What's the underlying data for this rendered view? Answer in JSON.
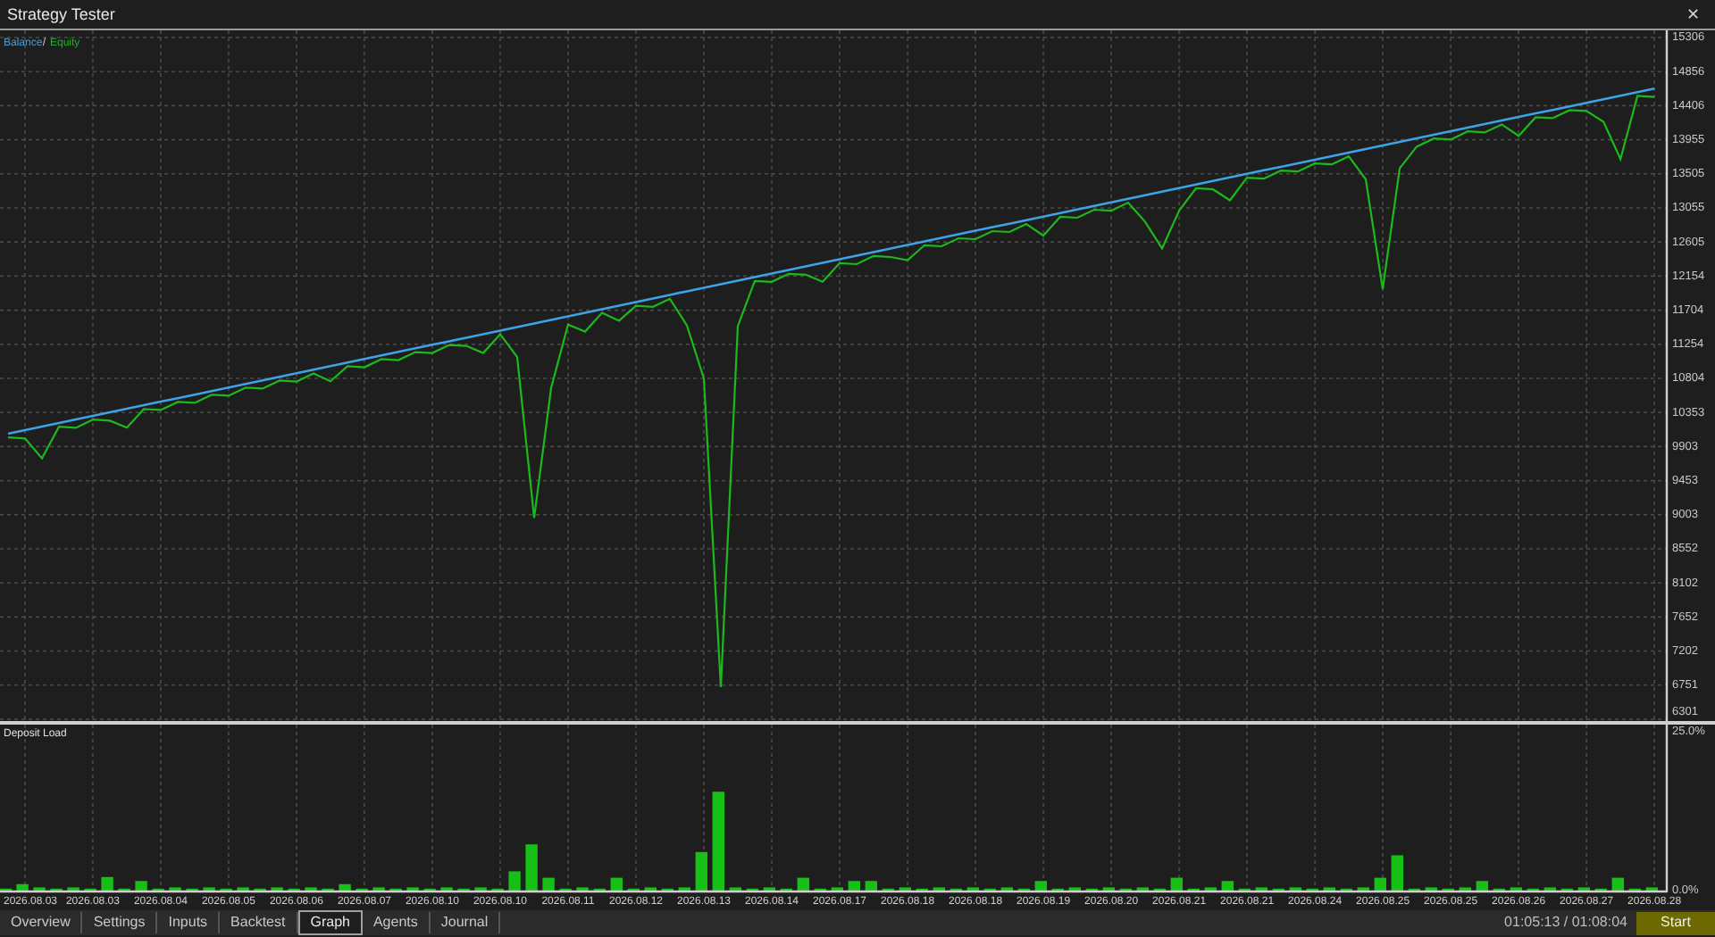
{
  "window": {
    "title": "Strategy Tester",
    "close": "✕"
  },
  "main_chart": {
    "legend_separator": "/",
    "chart_data": {
      "type": "line",
      "grid": true,
      "ylim": [
        6301,
        15306
      ],
      "yticks": [
        15306,
        14856,
        14406,
        13955,
        13505,
        13055,
        12605,
        12154,
        11704,
        11254,
        10804,
        10353,
        9903,
        9453,
        9003,
        8552,
        8102,
        7652,
        7202,
        6751,
        6301
      ],
      "series": [
        {
          "name": "Balance",
          "color": "#3ea2e6",
          "values": [
            10073,
            10120,
            10167,
            10214,
            10261,
            10308,
            10355,
            10402,
            10449,
            10496,
            10543,
            10590,
            10637,
            10684,
            10731,
            10778,
            10825,
            10872,
            10919,
            10966,
            11013,
            11060,
            11107,
            11154,
            11201,
            11248,
            11295,
            11342,
            11389,
            11436,
            11483,
            11530,
            11577,
            11624,
            11671,
            11718,
            11765,
            11812,
            11859,
            11906,
            11953,
            12000,
            12047,
            12094,
            12141,
            12188,
            12235,
            12282,
            12329,
            12376,
            12423,
            12470,
            12517,
            12564,
            12611,
            12658,
            12705,
            12752,
            12799,
            12846,
            12893,
            12940,
            12987,
            13034,
            13081,
            13128,
            13175,
            13222,
            13269,
            13316,
            13363,
            13410,
            13457,
            13504,
            13551,
            13598,
            13645,
            13692,
            13739,
            13786,
            13833,
            13880,
            13927,
            13974,
            14021,
            14068,
            14115,
            14162,
            14209,
            14256,
            14303,
            14350,
            14397,
            14444,
            14491,
            14538,
            14585,
            14632
          ]
        },
        {
          "name": "Equity",
          "color": "#1cb81c",
          "values": [
            10023,
            10010,
            9747,
            10164,
            10151,
            10258,
            10245,
            10152,
            10399,
            10386,
            10493,
            10480,
            10587,
            10574,
            10681,
            10668,
            10775,
            10762,
            10869,
            10766,
            10963,
            10950,
            11057,
            11044,
            11151,
            11138,
            11245,
            11232,
            11139,
            11386,
            11083,
            8960,
            10677,
            11514,
            11421,
            11668,
            11565,
            11762,
            11749,
            11856,
            11503,
            10800,
            6726,
            11494,
            12091,
            12078,
            12185,
            12172,
            12079,
            12326,
            12313,
            12420,
            12407,
            12364,
            12561,
            12548,
            12655,
            12642,
            12749,
            12736,
            12843,
            12690,
            12937,
            12924,
            13031,
            13018,
            13125,
            12872,
            12519,
            13016,
            13313,
            13300,
            13157,
            13454,
            13441,
            13548,
            13535,
            13642,
            13629,
            13736,
            13433,
            11982,
            13577,
            13864,
            13971,
            13958,
            14065,
            14052,
            14159,
            14006,
            14253,
            14240,
            14347,
            14334,
            14191,
            13700,
            14535,
            14522
          ]
        }
      ]
    }
  },
  "deposit_load": {
    "chart_data": {
      "type": "bar",
      "categories": [
        null,
        "2026.08.03",
        null,
        null,
        null,
        "2026.08.03",
        null,
        null,
        null,
        "2026.08.04",
        null,
        null,
        null,
        "2026.08.05",
        null,
        null,
        null,
        "2026.08.06",
        null,
        null,
        null,
        "2026.08.07",
        null,
        null,
        null,
        "2026.08.10",
        null,
        null,
        null,
        "2026.08.10",
        null,
        null,
        null,
        "2026.08.11",
        null,
        null,
        null,
        "2026.08.12",
        null,
        null,
        null,
        "2026.08.13",
        null,
        null,
        null,
        "2026.08.14",
        null,
        null,
        null,
        "2026.08.17",
        null,
        null,
        null,
        "2026.08.18",
        null,
        null,
        null,
        "2026.08.18",
        null,
        null,
        null,
        "2026.08.19",
        null,
        null,
        null,
        "2026.08.20",
        null,
        null,
        null,
        "2026.08.21",
        null,
        null,
        null,
        "2026.08.21",
        null,
        null,
        null,
        "2026.08.24",
        null,
        null,
        null,
        "2026.08.25",
        null,
        null,
        null,
        "2026.08.25",
        null,
        null,
        null,
        "2026.08.26",
        null,
        null,
        null,
        "2026.08.27",
        null,
        null,
        null,
        "2026.08.28"
      ],
      "grid": true,
      "ylim": [
        0,
        25
      ],
      "yticks": [
        {
          "value": 25,
          "label": "25.0%"
        },
        {
          "value": 0,
          "label": "0.0%"
        }
      ],
      "series": [
        {
          "name": "Deposit Load",
          "color": "#16c016",
          "values": [
            0.3,
            1.0,
            0.5,
            0.3,
            0.5,
            0.3,
            2.1,
            0.3,
            1.5,
            0.3,
            0.5,
            0.3,
            0.5,
            0.3,
            0.5,
            0.3,
            0.5,
            0.3,
            0.5,
            0.3,
            1.0,
            0.3,
            0.5,
            0.3,
            0.5,
            0.3,
            0.5,
            0.3,
            0.5,
            0.3,
            3.0,
            7.2,
            2.0,
            0.3,
            0.5,
            0.3,
            2.0,
            0.3,
            0.5,
            0.3,
            0.5,
            6.0,
            15.4,
            0.5,
            0.3,
            0.5,
            0.3,
            2.0,
            0.3,
            0.5,
            1.5,
            1.5,
            0.3,
            0.5,
            0.3,
            0.5,
            0.3,
            0.5,
            0.3,
            0.5,
            0.3,
            1.5,
            0.3,
            0.5,
            0.3,
            0.5,
            0.3,
            0.5,
            0.3,
            2.0,
            0.3,
            0.5,
            1.5,
            0.3,
            0.5,
            0.3,
            0.5,
            0.3,
            0.5,
            0.3,
            0.5,
            2.0,
            5.5,
            0.3,
            0.5,
            0.3,
            0.5,
            1.5,
            0.3,
            0.5,
            0.3,
            0.5,
            0.3,
            0.5,
            0.3,
            2.0,
            0.3,
            0.5
          ]
        }
      ]
    }
  },
  "tabs": [
    {
      "label": "Overview",
      "selected": false
    },
    {
      "label": "Settings",
      "selected": false
    },
    {
      "label": "Inputs",
      "selected": false
    },
    {
      "label": "Backtest",
      "selected": false
    },
    {
      "label": "Graph",
      "selected": true
    },
    {
      "label": "Agents",
      "selected": false
    },
    {
      "label": "Journal",
      "selected": false
    }
  ],
  "status": {
    "elapsed": "01:05:13 / 01:08:04",
    "start_button": "Start"
  }
}
